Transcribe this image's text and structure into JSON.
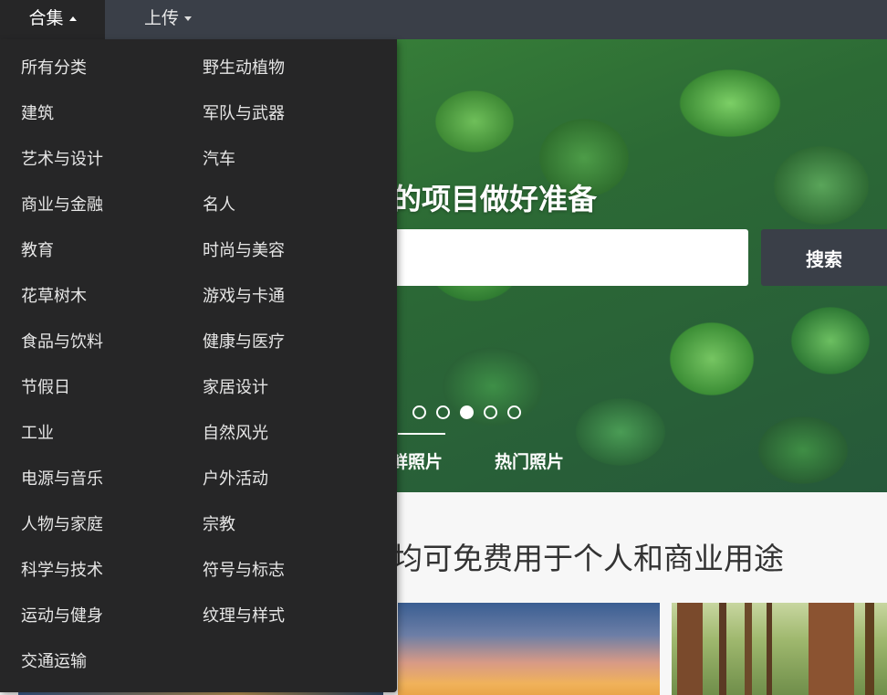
{
  "nav": {
    "collection_label": "合集",
    "upload_label": "上传"
  },
  "hero": {
    "title": "的项目做好准备",
    "search_button": "搜索",
    "carousel": {
      "count": 5,
      "active_index": 2
    },
    "tabs": [
      "鲜照片",
      "热门照片"
    ]
  },
  "tagline": "均可免费用于个人和商业用途",
  "dropdown": {
    "left_items": [
      "所有分类",
      "建筑",
      "艺术与设计",
      "商业与金融",
      "教育",
      "花草树木",
      "食品与饮料",
      "节假日",
      "工业",
      "电源与音乐",
      "人物与家庭",
      "科学与技术",
      "运动与健身",
      "交通运输"
    ],
    "right_items": [
      "野生动植物",
      "军队与武器",
      "汽车",
      "名人",
      "时尚与美容",
      "游戏与卡通",
      "健康与医疗",
      "家居设计",
      "自然风光",
      "户外活动",
      "宗教",
      "符号与标志",
      "纹理与样式"
    ]
  },
  "colors": {
    "nav_bg": "#3a3f48",
    "dropdown_bg": "#262627",
    "search_button_bg": "#3a3f48"
  }
}
